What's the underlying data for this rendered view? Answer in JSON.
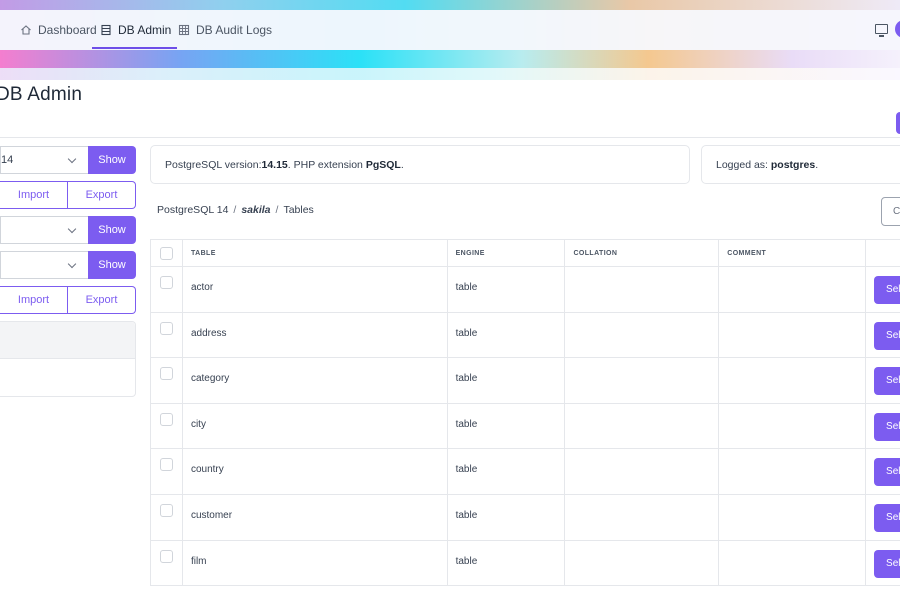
{
  "nav": {
    "back_icon": "chevron-left-icon",
    "tabs": [
      {
        "label": "Dashboard",
        "icon": "home-icon"
      },
      {
        "label": "DB Admin",
        "icon": "table-icon"
      },
      {
        "label": "DB Audit Logs",
        "icon": "grid-icon"
      }
    ],
    "active_tab": "DB Admin",
    "right_icons": [
      "monitor-icon",
      "avatar"
    ]
  },
  "page": {
    "title": "DB Admin"
  },
  "sidebar": {
    "server_select": {
      "value": "14",
      "button": "Show"
    },
    "import_export_1": {
      "import": "Import",
      "export": "Export"
    },
    "select_2": {
      "value": "",
      "button": "Show"
    },
    "select_3": {
      "value": "",
      "button": "Show"
    },
    "import_export_2": {
      "import": "Import",
      "export": "Export"
    }
  },
  "info": {
    "version_prefix": "PostgreSQL version: ",
    "version": "14.15",
    "ext_prefix": ". PHP extension ",
    "extension": "PgSQL",
    "ext_suffix": ".",
    "logged_prefix": "Logged as: ",
    "user": "postgres",
    "logged_suffix": "."
  },
  "breadcrumb": {
    "server": "PostgreSQL 14",
    "database": "sakila",
    "section": "Tables",
    "separator": "/"
  },
  "right_button_partial": "C",
  "table": {
    "headers": [
      "TABLE",
      "ENGINE",
      "COLLATION",
      "COMMENT"
    ],
    "action_label": "Sel",
    "rows": [
      {
        "name": "actor",
        "engine": "table",
        "collation": "",
        "comment": ""
      },
      {
        "name": "address",
        "engine": "table",
        "collation": "",
        "comment": ""
      },
      {
        "name": "category",
        "engine": "table",
        "collation": "",
        "comment": ""
      },
      {
        "name": "city",
        "engine": "table",
        "collation": "",
        "comment": ""
      },
      {
        "name": "country",
        "engine": "table",
        "collation": "",
        "comment": ""
      },
      {
        "name": "customer",
        "engine": "table",
        "collation": "",
        "comment": ""
      },
      {
        "name": "film",
        "engine": "table",
        "collation": "",
        "comment": ""
      }
    ]
  },
  "colors": {
    "accent": "#7c5cf0",
    "border": "#e5e7eb",
    "text": "#374151"
  }
}
